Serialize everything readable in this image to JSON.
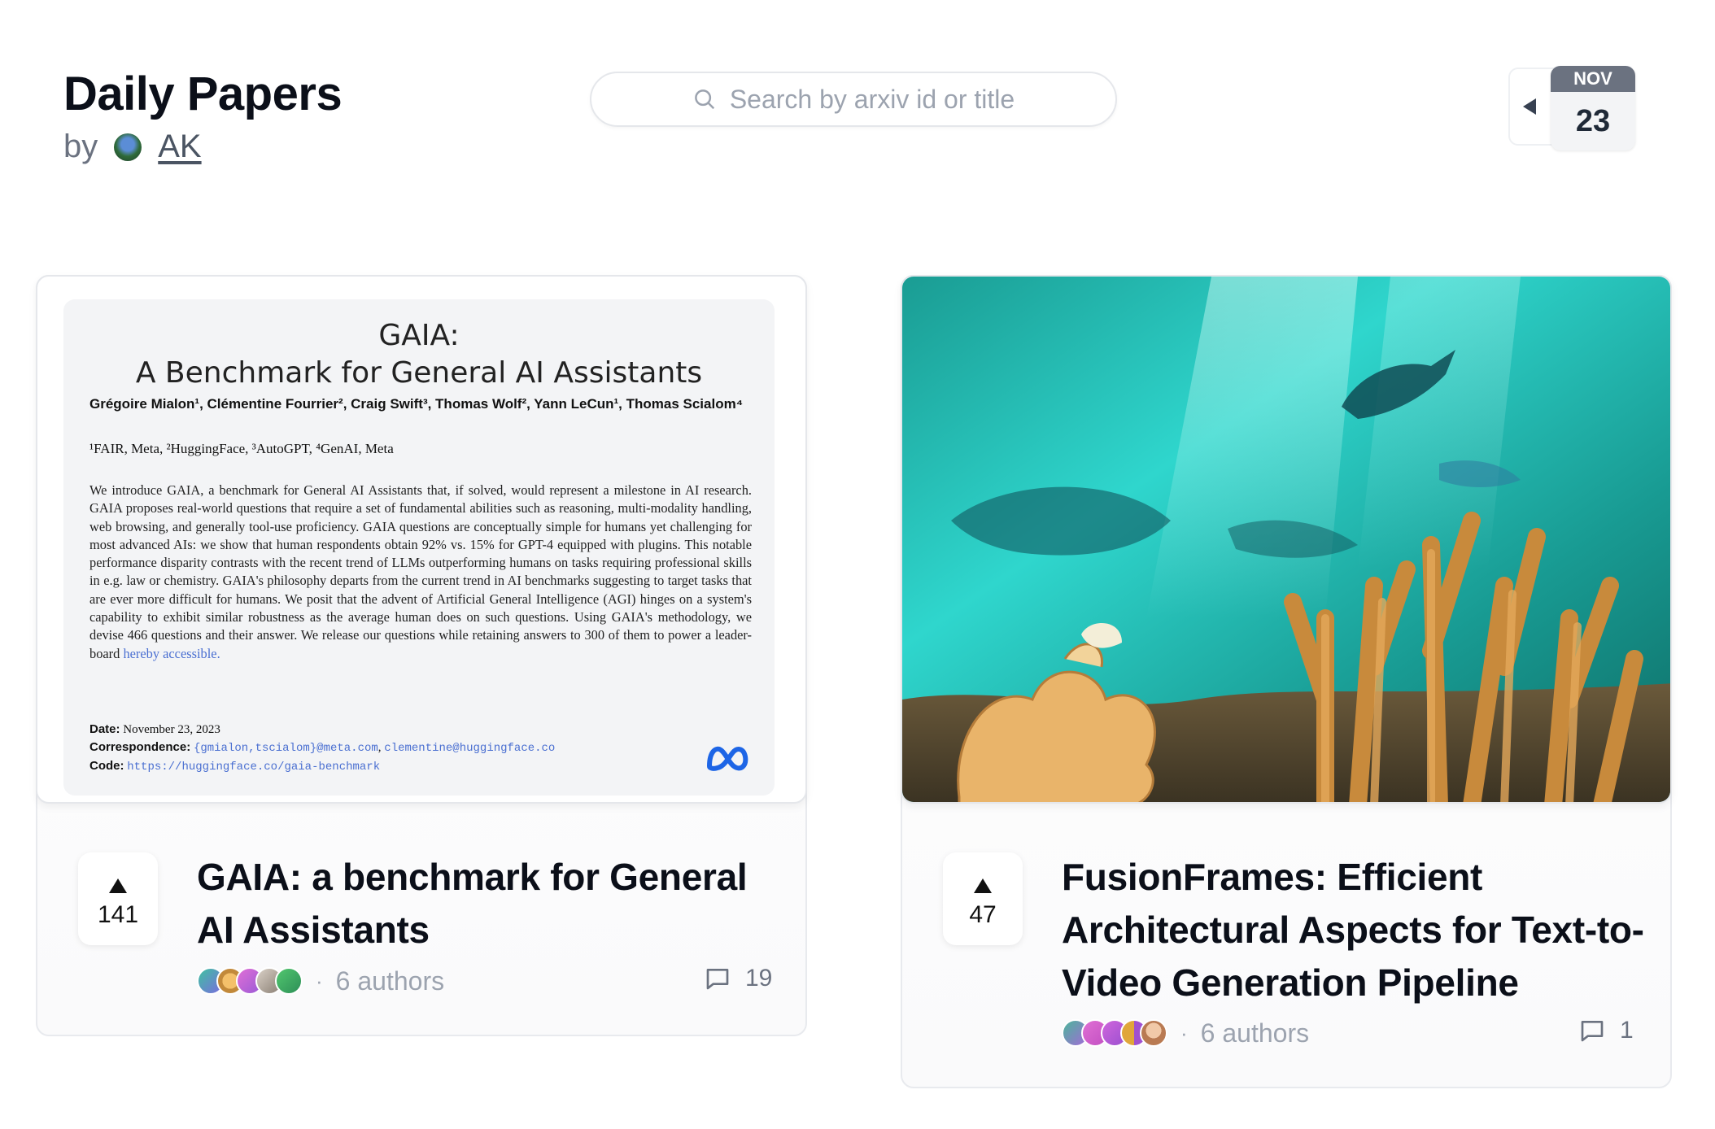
{
  "header": {
    "title": "Daily Papers",
    "by_label": "by",
    "author_name": "AK"
  },
  "search": {
    "placeholder": "Search by arxiv id or title"
  },
  "date": {
    "month": "NOV",
    "day": "23"
  },
  "papers": [
    {
      "title": "GAIA: a benchmark for General AI Assistants",
      "upvotes": "141",
      "authors_label": "6 authors",
      "comments": "19",
      "thumbnail": {
        "heading_line1": "GAIA:",
        "heading_line2": "A Benchmark for General AI Assistants",
        "authors": "Grégoire Mialon¹, Clémentine Fourrier², Craig Swift³, Thomas Wolf², Yann LeCun¹, Thomas Scialom⁴",
        "affiliations": "¹FAIR, Meta, ²HuggingFace, ³AutoGPT, ⁴GenAI, Meta",
        "abstract": "We introduce GAIA, a benchmark for General AI Assistants that, if solved, would represent a milestone in AI research. GAIA proposes real-world questions that require a set of fundamental abilities such as reasoning, multi-modality handling, web browsing, and generally tool-use proficiency. GAIA questions are conceptually simple for humans yet challenging for most advanced AIs: we show that human respondents obtain 92% vs. 15% for GPT-4 equipped with plugins. This notable performance disparity contrasts with the recent trend of LLMs outperforming humans on tasks requiring professional skills in e.g. law or chemistry. GAIA's philosophy departs from the current trend in AI benchmarks suggesting to target tasks that are ever more difficult for humans. We posit that the advent of Artificial General Intelligence (AGI) hinges on a system's capability to exhibit similar robustness as the average human does on such questions. Using GAIA's methodology, we devise 466 questions and their answer. We release our questions while retaining answers to 300 of them to power a leader-board",
        "abstract_link": "hereby accessible.",
        "date_label": "Date:",
        "date_value": "November 23, 2023",
        "correspondence_label": "Correspondence:",
        "correspondence_value": "{gmialon,tscialom}@meta.com",
        "correspondence_value2": "clementine@huggingface.co",
        "code_label": "Code:",
        "code_value": "https://huggingface.co/gaia-benchmark"
      },
      "avatar_colors": [
        "#3fc1a0",
        "#d9a441",
        "#c667d8",
        "#b8a99a",
        "#3ab56a"
      ]
    },
    {
      "title": "FusionFrames: Efficient Architectural Aspects for Text-to-Video Generation Pipeline",
      "upvotes": "47",
      "authors_label": "6 authors",
      "comments": "1",
      "avatar_colors": [
        "#4bb59a",
        "#d35fd0",
        "#c05ad6",
        "#e0a63a",
        "#c98f6b"
      ]
    }
  ]
}
